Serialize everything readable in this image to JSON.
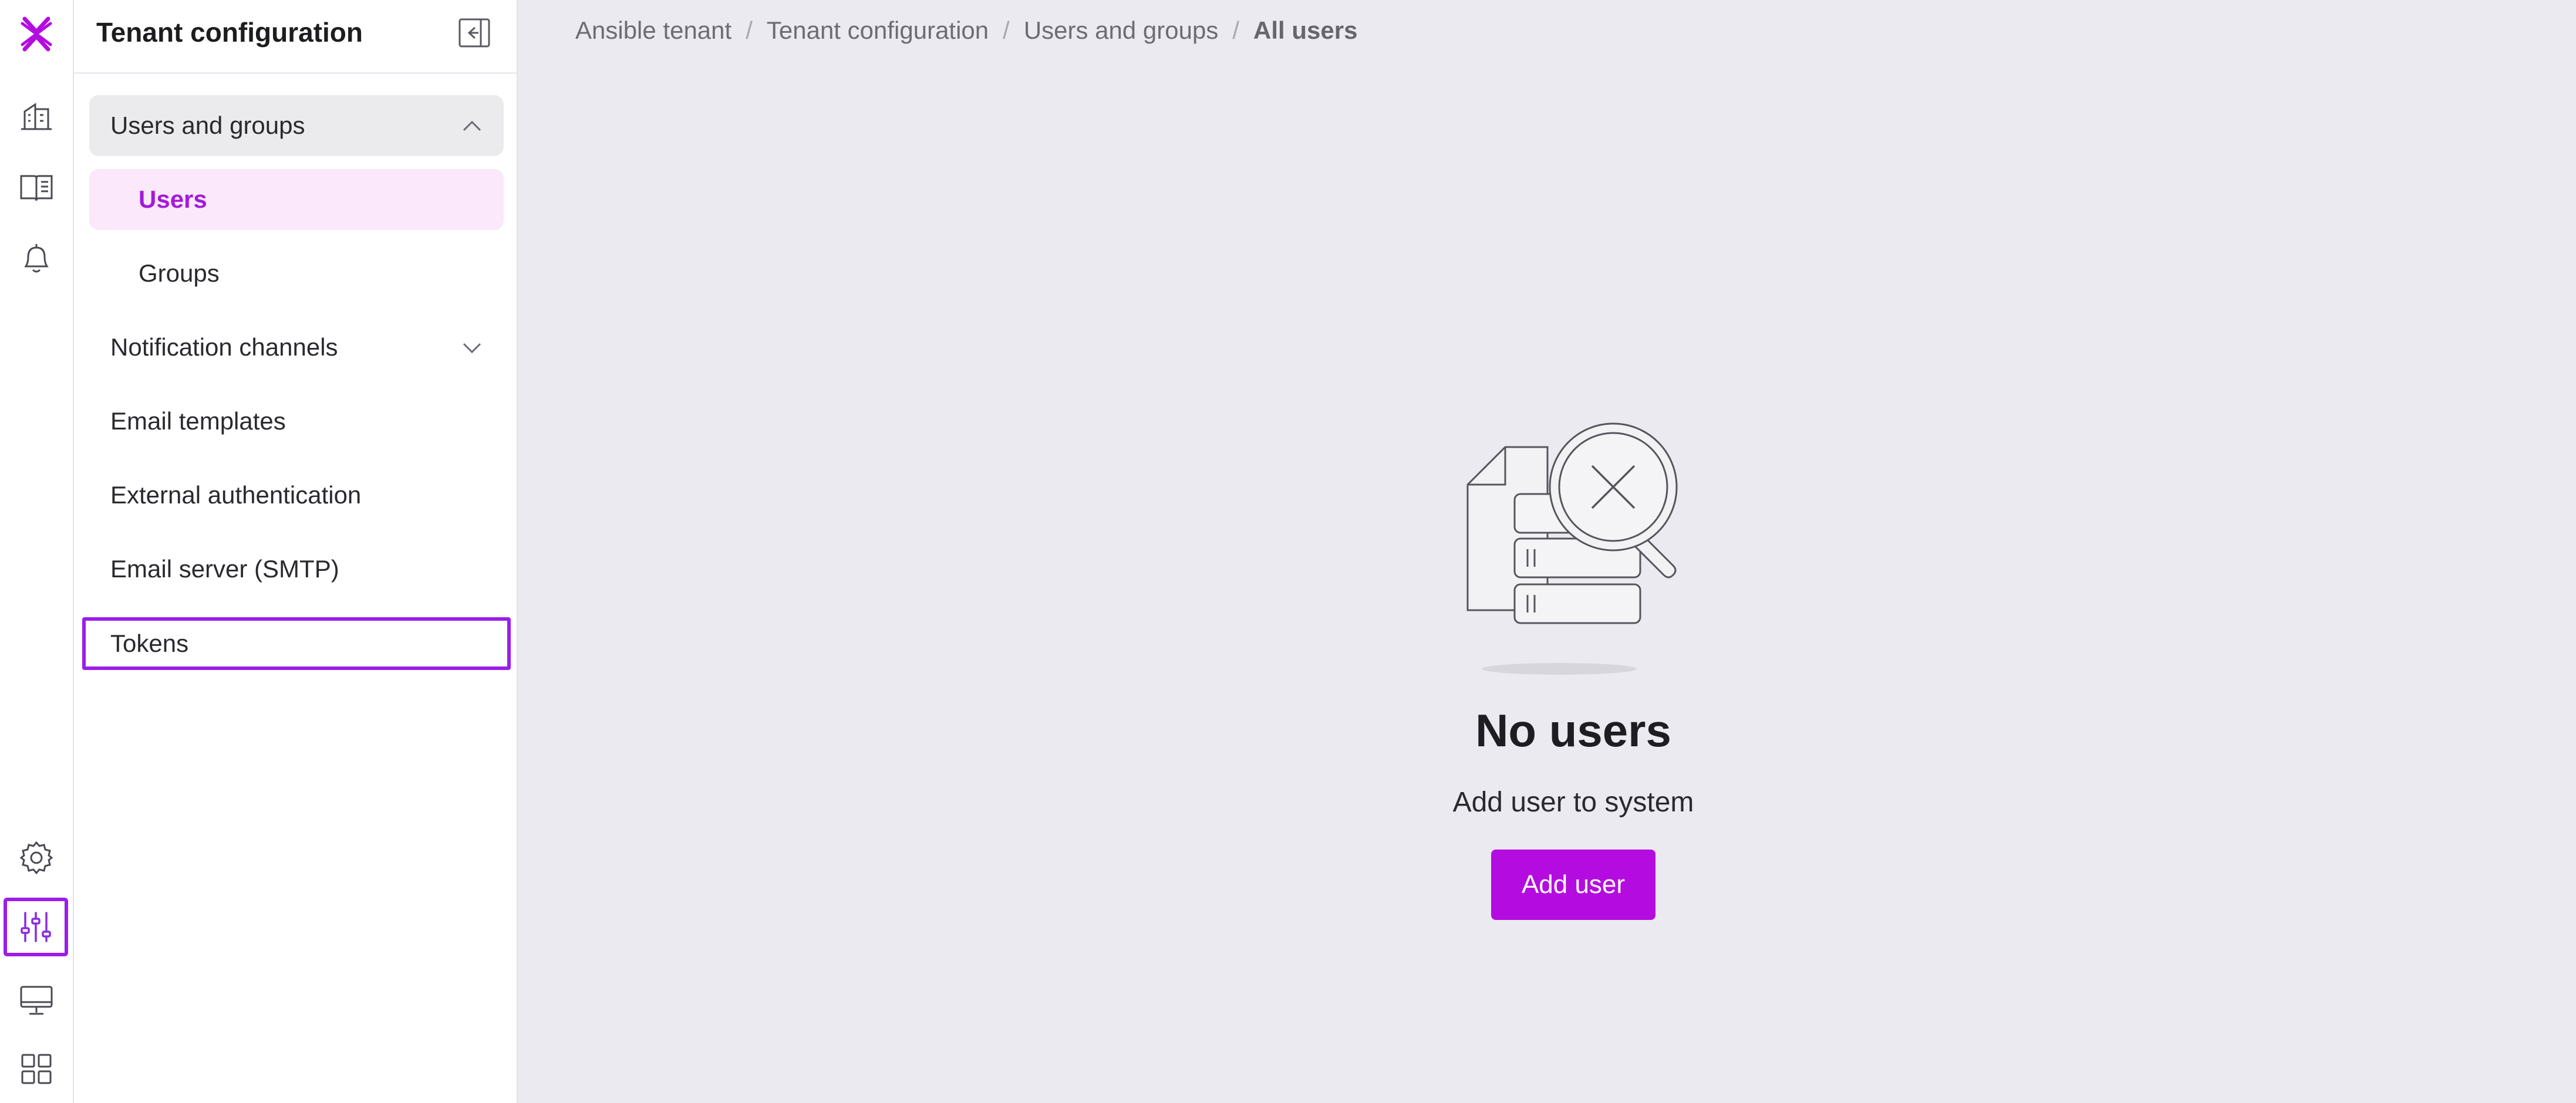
{
  "colors": {
    "accent": "#b40ce0",
    "accent_selected_text": "#a21ad9",
    "selected_bg": "#fbe8fb",
    "highlight_border": "#9b1ee8",
    "page_bg": "#ebeaf0"
  },
  "rail": {
    "items": [
      {
        "icon": "logo-x-icon"
      },
      {
        "icon": "buildings-icon"
      },
      {
        "icon": "book-icon"
      },
      {
        "icon": "bell-icon"
      },
      {
        "icon": "gear-icon"
      },
      {
        "icon": "sliders-icon",
        "active": true
      },
      {
        "icon": "monitor-icon"
      },
      {
        "icon": "grid-icon"
      }
    ]
  },
  "panel": {
    "title": "Tenant configuration",
    "items": [
      {
        "label": "Users and groups",
        "expanded": true
      },
      {
        "label": "Users",
        "selected": true
      },
      {
        "label": "Groups"
      },
      {
        "label": "Notification channels",
        "expanded": false
      },
      {
        "label": "Email templates"
      },
      {
        "label": "External authentication"
      },
      {
        "label": "Email server (SMTP)"
      },
      {
        "label": "Tokens"
      }
    ]
  },
  "breadcrumb": {
    "items": [
      "Ansible tenant",
      "Tenant configuration",
      "Users and groups",
      "All users"
    ],
    "separator": "/"
  },
  "empty_state": {
    "icon": "no-results-magnifier-icon",
    "title": "No users",
    "subtitle": "Add user to system",
    "button_label": "Add user"
  }
}
